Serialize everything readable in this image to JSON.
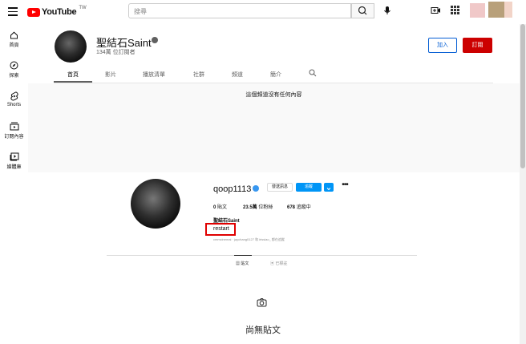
{
  "header": {
    "logo_text": "YouTube",
    "region": "TW",
    "search_placeholder": "搜尋"
  },
  "sidebar": {
    "items": [
      {
        "label": "首頁",
        "icon": "home-icon"
      },
      {
        "label": "探索",
        "icon": "compass-icon"
      },
      {
        "label": "Shorts",
        "icon": "shorts-icon"
      },
      {
        "label": "訂閱內容",
        "icon": "subscriptions-icon"
      },
      {
        "label": "媒體庫",
        "icon": "library-icon"
      }
    ]
  },
  "channel": {
    "name": "聖結石Saint",
    "subscribers": "134萬 位訂閱者",
    "join_label": "加入",
    "subscribe_label": "訂閱",
    "tabs": [
      "首頁",
      "影片",
      "播放清單",
      "社群",
      "頻道",
      "簡介"
    ],
    "active_tab": "首頁",
    "empty_message": "這個頻道沒有任何內容"
  },
  "instagram": {
    "username": "qoop1113",
    "message_label": "發送訊息",
    "follow_label": "追蹤",
    "stats": {
      "posts": "0",
      "posts_label": "貼文",
      "followers": "23.5萬",
      "followers_label": "位粉絲",
      "following": "678",
      "following_label": "追蹤中"
    },
    "full_name": "聖結石Saint",
    "bio": "restart",
    "followed_by": "cmmcinemai  ·  jaychang0127 和 irissiao_ 都在追蹤",
    "tabs": [
      {
        "label": "貼文",
        "icon": "grid-icon"
      },
      {
        "label": "已標註",
        "icon": "tag-icon"
      }
    ],
    "empty_title": "尚無貼文"
  },
  "colors": {
    "brand_red": "#ff0000",
    "subscribe_red": "#cc0000",
    "join_blue": "#065fd4",
    "ig_blue": "#0095f6",
    "highlight_box": "#e00000"
  }
}
